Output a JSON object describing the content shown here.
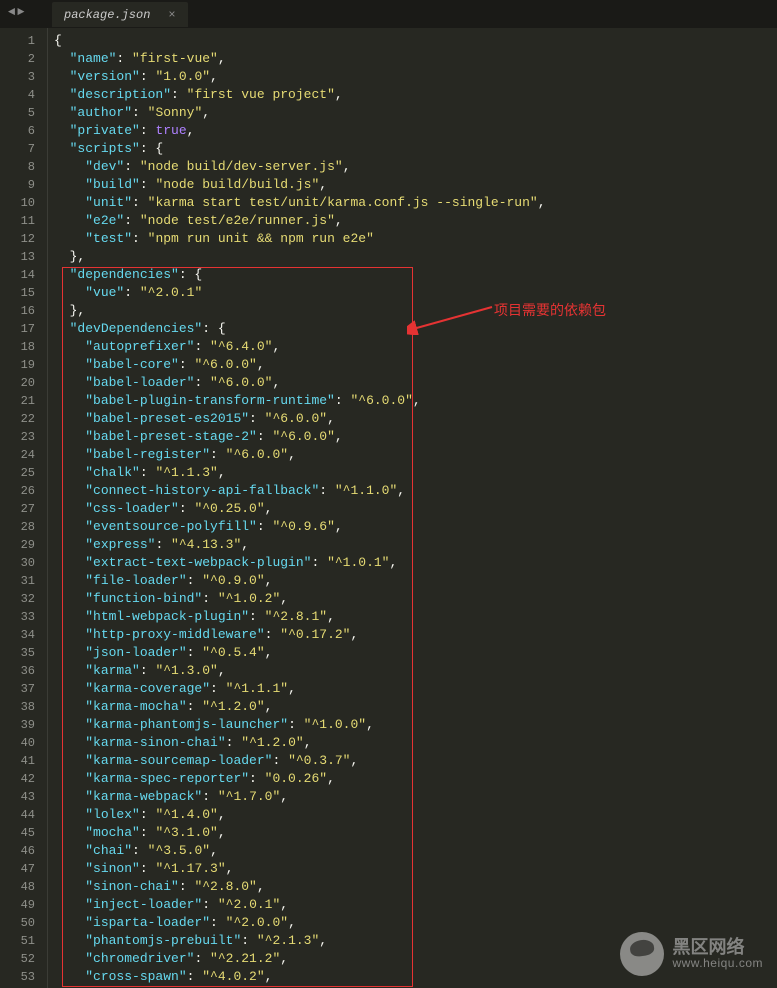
{
  "tab": {
    "title": "package.json",
    "close": "×"
  },
  "nav": {
    "back": "◄",
    "fwd": "►"
  },
  "annotation": "项目需要的依赖包",
  "watermark": {
    "line1": "黑区网络",
    "line2": "www.heiqu.com"
  },
  "numbers": [
    "1",
    "2",
    "3",
    "4",
    "5",
    "6",
    "7",
    "8",
    "9",
    "10",
    "11",
    "12",
    "13",
    "14",
    "15",
    "16",
    "17",
    "18",
    "19",
    "20",
    "21",
    "22",
    "23",
    "24",
    "25",
    "26",
    "27",
    "28",
    "29",
    "30",
    "31",
    "32",
    "33",
    "34",
    "35",
    "36",
    "37",
    "38",
    "39",
    "40",
    "41",
    "42",
    "43",
    "44",
    "45",
    "46",
    "47",
    "48",
    "49",
    "50",
    "51",
    "52",
    "53"
  ],
  "code": [
    [
      [
        "p",
        "{"
      ]
    ],
    [
      [
        "p",
        "  "
      ],
      [
        "k",
        "\"name\""
      ],
      [
        "p",
        ": "
      ],
      [
        "s",
        "\"first-vue\""
      ],
      [
        "p",
        ","
      ]
    ],
    [
      [
        "p",
        "  "
      ],
      [
        "k",
        "\"version\""
      ],
      [
        "p",
        ": "
      ],
      [
        "s",
        "\"1.0.0\""
      ],
      [
        "p",
        ","
      ]
    ],
    [
      [
        "p",
        "  "
      ],
      [
        "k",
        "\"description\""
      ],
      [
        "p",
        ": "
      ],
      [
        "s",
        "\"first vue project\""
      ],
      [
        "p",
        ","
      ]
    ],
    [
      [
        "p",
        "  "
      ],
      [
        "k",
        "\"author\""
      ],
      [
        "p",
        ": "
      ],
      [
        "s",
        "\"Sonny\""
      ],
      [
        "p",
        ","
      ]
    ],
    [
      [
        "p",
        "  "
      ],
      [
        "k",
        "\"private\""
      ],
      [
        "p",
        ": "
      ],
      [
        "kw",
        "true"
      ],
      [
        "p",
        ","
      ]
    ],
    [
      [
        "p",
        "  "
      ],
      [
        "k",
        "\"scripts\""
      ],
      [
        "p",
        ": {"
      ]
    ],
    [
      [
        "p",
        "    "
      ],
      [
        "k",
        "\"dev\""
      ],
      [
        "p",
        ": "
      ],
      [
        "s",
        "\"node build/dev-server.js\""
      ],
      [
        "p",
        ","
      ]
    ],
    [
      [
        "p",
        "    "
      ],
      [
        "k",
        "\"build\""
      ],
      [
        "p",
        ": "
      ],
      [
        "s",
        "\"node build/build.js\""
      ],
      [
        "p",
        ","
      ]
    ],
    [
      [
        "p",
        "    "
      ],
      [
        "k",
        "\"unit\""
      ],
      [
        "p",
        ": "
      ],
      [
        "s",
        "\"karma start test/unit/karma.conf.js --single-run\""
      ],
      [
        "p",
        ","
      ]
    ],
    [
      [
        "p",
        "    "
      ],
      [
        "k",
        "\"e2e\""
      ],
      [
        "p",
        ": "
      ],
      [
        "s",
        "\"node test/e2e/runner.js\""
      ],
      [
        "p",
        ","
      ]
    ],
    [
      [
        "p",
        "    "
      ],
      [
        "k",
        "\"test\""
      ],
      [
        "p",
        ": "
      ],
      [
        "s",
        "\"npm run unit && npm run e2e\""
      ]
    ],
    [
      [
        "p",
        "  },"
      ]
    ],
    [
      [
        "p",
        "  "
      ],
      [
        "k",
        "\"dependencies\""
      ],
      [
        "p",
        ": {"
      ]
    ],
    [
      [
        "p",
        "    "
      ],
      [
        "k",
        "\"vue\""
      ],
      [
        "p",
        ": "
      ],
      [
        "s",
        "\"^2.0.1\""
      ]
    ],
    [
      [
        "p",
        "  },"
      ]
    ],
    [
      [
        "p",
        "  "
      ],
      [
        "k",
        "\"devDependencies\""
      ],
      [
        "p",
        ": {"
      ]
    ],
    [
      [
        "p",
        "    "
      ],
      [
        "k",
        "\"autoprefixer\""
      ],
      [
        "p",
        ": "
      ],
      [
        "s",
        "\"^6.4.0\""
      ],
      [
        "p",
        ","
      ]
    ],
    [
      [
        "p",
        "    "
      ],
      [
        "k",
        "\"babel-core\""
      ],
      [
        "p",
        ": "
      ],
      [
        "s",
        "\"^6.0.0\""
      ],
      [
        "p",
        ","
      ]
    ],
    [
      [
        "p",
        "    "
      ],
      [
        "k",
        "\"babel-loader\""
      ],
      [
        "p",
        ": "
      ],
      [
        "s",
        "\"^6.0.0\""
      ],
      [
        "p",
        ","
      ]
    ],
    [
      [
        "p",
        "    "
      ],
      [
        "k",
        "\"babel-plugin-transform-runtime\""
      ],
      [
        "p",
        ": "
      ],
      [
        "s",
        "\"^6.0.0\""
      ],
      [
        "p",
        ","
      ]
    ],
    [
      [
        "p",
        "    "
      ],
      [
        "k",
        "\"babel-preset-es2015\""
      ],
      [
        "p",
        ": "
      ],
      [
        "s",
        "\"^6.0.0\""
      ],
      [
        "p",
        ","
      ]
    ],
    [
      [
        "p",
        "    "
      ],
      [
        "k",
        "\"babel-preset-stage-2\""
      ],
      [
        "p",
        ": "
      ],
      [
        "s",
        "\"^6.0.0\""
      ],
      [
        "p",
        ","
      ]
    ],
    [
      [
        "p",
        "    "
      ],
      [
        "k",
        "\"babel-register\""
      ],
      [
        "p",
        ": "
      ],
      [
        "s",
        "\"^6.0.0\""
      ],
      [
        "p",
        ","
      ]
    ],
    [
      [
        "p",
        "    "
      ],
      [
        "k",
        "\"chalk\""
      ],
      [
        "p",
        ": "
      ],
      [
        "s",
        "\"^1.1.3\""
      ],
      [
        "p",
        ","
      ]
    ],
    [
      [
        "p",
        "    "
      ],
      [
        "k",
        "\"connect-history-api-fallback\""
      ],
      [
        "p",
        ": "
      ],
      [
        "s",
        "\"^1.1.0\""
      ],
      [
        "p",
        ","
      ]
    ],
    [
      [
        "p",
        "    "
      ],
      [
        "k",
        "\"css-loader\""
      ],
      [
        "p",
        ": "
      ],
      [
        "s",
        "\"^0.25.0\""
      ],
      [
        "p",
        ","
      ]
    ],
    [
      [
        "p",
        "    "
      ],
      [
        "k",
        "\"eventsource-polyfill\""
      ],
      [
        "p",
        ": "
      ],
      [
        "s",
        "\"^0.9.6\""
      ],
      [
        "p",
        ","
      ]
    ],
    [
      [
        "p",
        "    "
      ],
      [
        "k",
        "\"express\""
      ],
      [
        "p",
        ": "
      ],
      [
        "s",
        "\"^4.13.3\""
      ],
      [
        "p",
        ","
      ]
    ],
    [
      [
        "p",
        "    "
      ],
      [
        "k",
        "\"extract-text-webpack-plugin\""
      ],
      [
        "p",
        ": "
      ],
      [
        "s",
        "\"^1.0.1\""
      ],
      [
        "p",
        ","
      ]
    ],
    [
      [
        "p",
        "    "
      ],
      [
        "k",
        "\"file-loader\""
      ],
      [
        "p",
        ": "
      ],
      [
        "s",
        "\"^0.9.0\""
      ],
      [
        "p",
        ","
      ]
    ],
    [
      [
        "p",
        "    "
      ],
      [
        "k",
        "\"function-bind\""
      ],
      [
        "p",
        ": "
      ],
      [
        "s",
        "\"^1.0.2\""
      ],
      [
        "p",
        ","
      ]
    ],
    [
      [
        "p",
        "    "
      ],
      [
        "k",
        "\"html-webpack-plugin\""
      ],
      [
        "p",
        ": "
      ],
      [
        "s",
        "\"^2.8.1\""
      ],
      [
        "p",
        ","
      ]
    ],
    [
      [
        "p",
        "    "
      ],
      [
        "k",
        "\"http-proxy-middleware\""
      ],
      [
        "p",
        ": "
      ],
      [
        "s",
        "\"^0.17.2\""
      ],
      [
        "p",
        ","
      ]
    ],
    [
      [
        "p",
        "    "
      ],
      [
        "k",
        "\"json-loader\""
      ],
      [
        "p",
        ": "
      ],
      [
        "s",
        "\"^0.5.4\""
      ],
      [
        "p",
        ","
      ]
    ],
    [
      [
        "p",
        "    "
      ],
      [
        "k",
        "\"karma\""
      ],
      [
        "p",
        ": "
      ],
      [
        "s",
        "\"^1.3.0\""
      ],
      [
        "p",
        ","
      ]
    ],
    [
      [
        "p",
        "    "
      ],
      [
        "k",
        "\"karma-coverage\""
      ],
      [
        "p",
        ": "
      ],
      [
        "s",
        "\"^1.1.1\""
      ],
      [
        "p",
        ","
      ]
    ],
    [
      [
        "p",
        "    "
      ],
      [
        "k",
        "\"karma-mocha\""
      ],
      [
        "p",
        ": "
      ],
      [
        "s",
        "\"^1.2.0\""
      ],
      [
        "p",
        ","
      ]
    ],
    [
      [
        "p",
        "    "
      ],
      [
        "k",
        "\"karma-phantomjs-launcher\""
      ],
      [
        "p",
        ": "
      ],
      [
        "s",
        "\"^1.0.0\""
      ],
      [
        "p",
        ","
      ]
    ],
    [
      [
        "p",
        "    "
      ],
      [
        "k",
        "\"karma-sinon-chai\""
      ],
      [
        "p",
        ": "
      ],
      [
        "s",
        "\"^1.2.0\""
      ],
      [
        "p",
        ","
      ]
    ],
    [
      [
        "p",
        "    "
      ],
      [
        "k",
        "\"karma-sourcemap-loader\""
      ],
      [
        "p",
        ": "
      ],
      [
        "s",
        "\"^0.3.7\""
      ],
      [
        "p",
        ","
      ]
    ],
    [
      [
        "p",
        "    "
      ],
      [
        "k",
        "\"karma-spec-reporter\""
      ],
      [
        "p",
        ": "
      ],
      [
        "s",
        "\"0.0.26\""
      ],
      [
        "p",
        ","
      ]
    ],
    [
      [
        "p",
        "    "
      ],
      [
        "k",
        "\"karma-webpack\""
      ],
      [
        "p",
        ": "
      ],
      [
        "s",
        "\"^1.7.0\""
      ],
      [
        "p",
        ","
      ]
    ],
    [
      [
        "p",
        "    "
      ],
      [
        "k",
        "\"lolex\""
      ],
      [
        "p",
        ": "
      ],
      [
        "s",
        "\"^1.4.0\""
      ],
      [
        "p",
        ","
      ]
    ],
    [
      [
        "p",
        "    "
      ],
      [
        "k",
        "\"mocha\""
      ],
      [
        "p",
        ": "
      ],
      [
        "s",
        "\"^3.1.0\""
      ],
      [
        "p",
        ","
      ]
    ],
    [
      [
        "p",
        "    "
      ],
      [
        "k",
        "\"chai\""
      ],
      [
        "p",
        ": "
      ],
      [
        "s",
        "\"^3.5.0\""
      ],
      [
        "p",
        ","
      ]
    ],
    [
      [
        "p",
        "    "
      ],
      [
        "k",
        "\"sinon\""
      ],
      [
        "p",
        ": "
      ],
      [
        "s",
        "\"^1.17.3\""
      ],
      [
        "p",
        ","
      ]
    ],
    [
      [
        "p",
        "    "
      ],
      [
        "k",
        "\"sinon-chai\""
      ],
      [
        "p",
        ": "
      ],
      [
        "s",
        "\"^2.8.0\""
      ],
      [
        "p",
        ","
      ]
    ],
    [
      [
        "p",
        "    "
      ],
      [
        "k",
        "\"inject-loader\""
      ],
      [
        "p",
        ": "
      ],
      [
        "s",
        "\"^2.0.1\""
      ],
      [
        "p",
        ","
      ]
    ],
    [
      [
        "p",
        "    "
      ],
      [
        "k",
        "\"isparta-loader\""
      ],
      [
        "p",
        ": "
      ],
      [
        "s",
        "\"^2.0.0\""
      ],
      [
        "p",
        ","
      ]
    ],
    [
      [
        "p",
        "    "
      ],
      [
        "k",
        "\"phantomjs-prebuilt\""
      ],
      [
        "p",
        ": "
      ],
      [
        "s",
        "\"^2.1.3\""
      ],
      [
        "p",
        ","
      ]
    ],
    [
      [
        "p",
        "    "
      ],
      [
        "k",
        "\"chromedriver\""
      ],
      [
        "p",
        ": "
      ],
      [
        "s",
        "\"^2.21.2\""
      ],
      [
        "p",
        ","
      ]
    ],
    [
      [
        "p",
        "    "
      ],
      [
        "k",
        "\"cross-spawn\""
      ],
      [
        "p",
        ": "
      ],
      [
        "s",
        "\"^4.0.2\""
      ],
      [
        "p",
        ","
      ]
    ]
  ]
}
